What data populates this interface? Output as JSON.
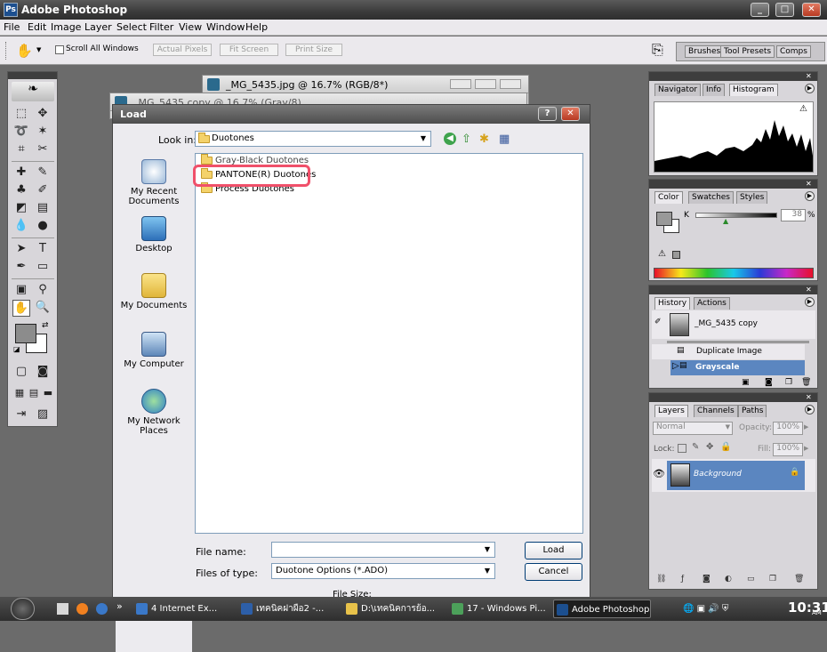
{
  "app": {
    "title": "Adobe Photoshop",
    "window_buttons": [
      "_",
      "□",
      "✕"
    ]
  },
  "menu": [
    "File",
    "Edit",
    "Image",
    "Layer",
    "Select",
    "Filter",
    "View",
    "Window",
    "Help"
  ],
  "options_bar": {
    "scroll_all_windows": "Scroll All Windows",
    "actual_pixels": "Actual Pixels",
    "fit_screen": "Fit Screen",
    "print_size": "Print Size",
    "well_tabs": [
      "Brushes",
      "Tool Presets",
      "Comps"
    ]
  },
  "documents": [
    {
      "title": "_MG_5435.jpg @ 16.7% (RGB/8*)"
    },
    {
      "title": "_MG_5435 copy @ 16.7% (Gray/8)"
    }
  ],
  "dialog": {
    "title": "Load",
    "look_in_label": "Look in:",
    "look_in_value": "Duotones",
    "places": [
      "My Recent Documents",
      "Desktop",
      "My Documents",
      "My Computer",
      "My Network Places"
    ],
    "files": [
      "Gray-Black Duotones",
      "PANTONE(R) Duotones",
      "Process Duotones"
    ],
    "highlighted_file": "PANTONE(R) Duotones",
    "file_name_label": "File name:",
    "file_name_value": "",
    "file_type_label": "Files of type:",
    "file_type_value": "Duotone Options (*.ADO)",
    "load_button": "Load",
    "cancel_button": "Cancel",
    "file_size_label": "File Size:"
  },
  "navigator_palette": {
    "tabs": [
      "Navigator",
      "Info",
      "Histogram"
    ],
    "active": "Histogram"
  },
  "color_palette": {
    "tabs": [
      "Color",
      "Swatches",
      "Styles"
    ],
    "active": "Color",
    "channel": "K",
    "value": "38",
    "unit": "%"
  },
  "history_palette": {
    "tabs": [
      "History",
      "Actions"
    ],
    "active": "History",
    "snapshot": "_MG_5435 copy",
    "states": [
      "Duplicate Image",
      "Grayscale"
    ],
    "selected_state": "Grayscale"
  },
  "layers_palette": {
    "tabs": [
      "Layers",
      "Channels",
      "Paths"
    ],
    "active": "Layers",
    "blend_mode": "Normal",
    "opacity_label": "Opacity:",
    "opacity_value": "100%",
    "lock_label": "Lock:",
    "fill_label": "Fill:",
    "fill_value": "100%",
    "layers": [
      "Background"
    ]
  },
  "taskbar": {
    "tasks": [
      "4 Internet Ex...",
      "เทคนิคฝาผือ2 -...",
      "D:\\เทคนิคการย้อ...",
      "17 - Windows Pi...",
      "Adobe Photoshop"
    ],
    "active_task": "Adobe Photoshop",
    "clock": "10:31",
    "clock_suffix": "AM",
    "chevron": "»"
  },
  "colors": {
    "highlight_ring": "#f0506a",
    "selection_blue": "#5b86c0",
    "titlebar_dark": "#3b3b3b"
  }
}
